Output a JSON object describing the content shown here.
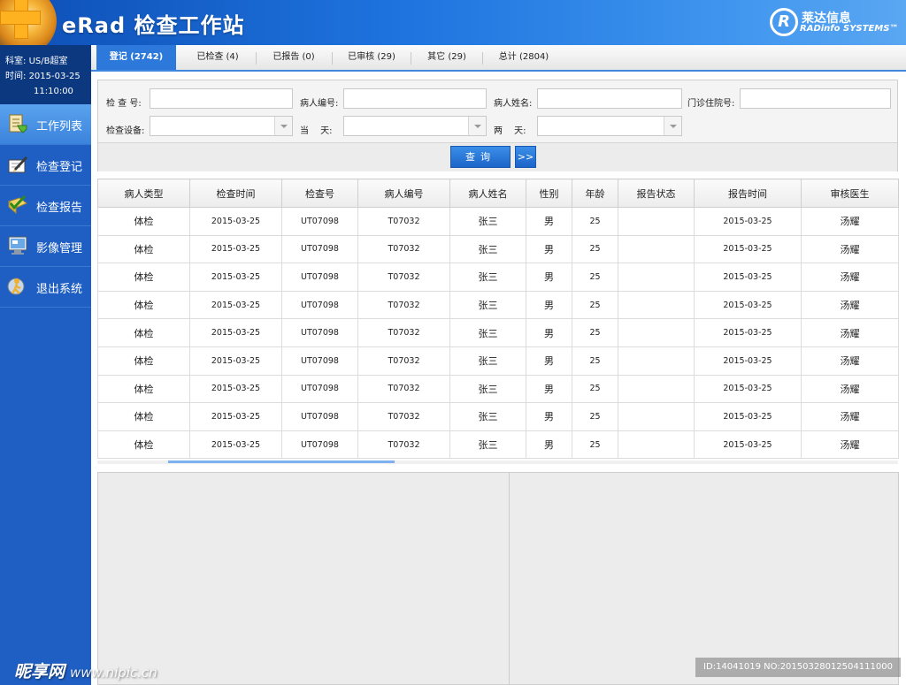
{
  "header": {
    "app_title": "eRad 检查工作站",
    "brand_mark": "R",
    "brand_cn": "莱达信息",
    "brand_en": "RADinfo SYSTEMS™"
  },
  "sidebar": {
    "dept_label": "科室:",
    "dept_value": "US/B超室",
    "time_label": "时间:",
    "time_date": "2015-03-25",
    "time_clock": "11:10:00",
    "items": [
      {
        "label": "工作列表",
        "icon": "worklist-icon",
        "active": true
      },
      {
        "label": "检查登记",
        "icon": "register-pen-icon",
        "active": false
      },
      {
        "label": "检查报告",
        "icon": "report-check-icon",
        "active": false
      },
      {
        "label": "影像管理",
        "icon": "monitor-icon",
        "active": false
      },
      {
        "label": "退出系统",
        "icon": "exit-icon",
        "active": false
      }
    ]
  },
  "tabs": [
    {
      "label": "登记 (2742)",
      "active": true
    },
    {
      "label": "已检查 (4)",
      "active": false
    },
    {
      "label": "已报告 (0)",
      "active": false
    },
    {
      "label": "已审核 (29)",
      "active": false
    },
    {
      "label": "其它 (29)",
      "active": false
    },
    {
      "label": "总计 (2804)",
      "active": false
    }
  ],
  "search": {
    "exam_no_label": "检 查 号:",
    "exam_no_value": "",
    "patient_no_label": "病人编号:",
    "patient_no_value": "",
    "patient_name_label": "病人姓名:",
    "patient_name_value": "",
    "clinic_no_label": "门诊住院号:",
    "clinic_no_value": "",
    "device_label": "检查设备:",
    "device_value": "",
    "today_label": "当　 天:",
    "today_value": "",
    "two_days_label": "两　 天:",
    "two_days_value": "",
    "query_button": "查询",
    "more_button": ">>"
  },
  "table": {
    "columns": [
      "病人类型",
      "检查时间",
      "检查号",
      "病人编号",
      "病人姓名",
      "性别",
      "年龄",
      "报告状态",
      "报告时间",
      "审核医生"
    ],
    "rows": [
      [
        "体检",
        "2015-03-25",
        "UT07098",
        "T07032",
        "张三",
        "男",
        "25",
        "",
        "2015-03-25",
        "汤耀"
      ],
      [
        "体检",
        "2015-03-25",
        "UT07098",
        "T07032",
        "张三",
        "男",
        "25",
        "",
        "2015-03-25",
        "汤耀"
      ],
      [
        "体检",
        "2015-03-25",
        "UT07098",
        "T07032",
        "张三",
        "男",
        "25",
        "",
        "2015-03-25",
        "汤耀"
      ],
      [
        "体检",
        "2015-03-25",
        "UT07098",
        "T07032",
        "张三",
        "男",
        "25",
        "",
        "2015-03-25",
        "汤耀"
      ],
      [
        "体检",
        "2015-03-25",
        "UT07098",
        "T07032",
        "张三",
        "男",
        "25",
        "",
        "2015-03-25",
        "汤耀"
      ],
      [
        "体检",
        "2015-03-25",
        "UT07098",
        "T07032",
        "张三",
        "男",
        "25",
        "",
        "2015-03-25",
        "汤耀"
      ],
      [
        "体检",
        "2015-03-25",
        "UT07098",
        "T07032",
        "张三",
        "男",
        "25",
        "",
        "2015-03-25",
        "汤耀"
      ],
      [
        "体检",
        "2015-03-25",
        "UT07098",
        "T07032",
        "张三",
        "男",
        "25",
        "",
        "2015-03-25",
        "汤耀"
      ],
      [
        "体检",
        "2015-03-25",
        "UT07098",
        "T07032",
        "张三",
        "男",
        "25",
        "",
        "2015-03-25",
        "汤耀"
      ]
    ]
  },
  "watermark": {
    "left_cn": "昵享网",
    "left_url": "www.nipic.cn",
    "right": "ID:14041019 NO:20150328012504111000"
  }
}
